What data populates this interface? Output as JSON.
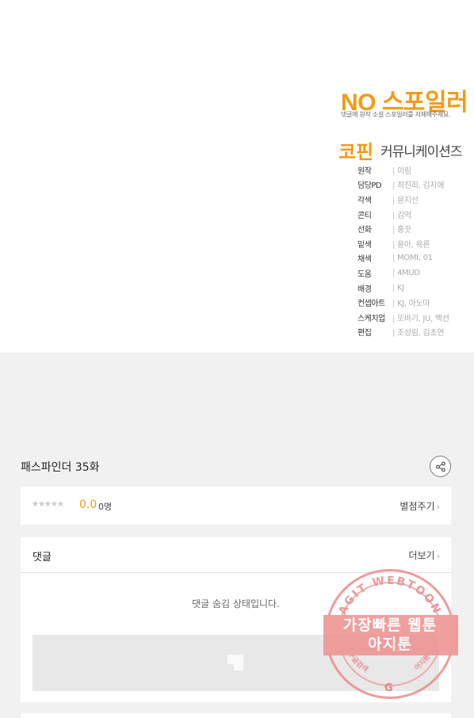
{
  "panel": {
    "no_spoiler": "NO 스포일러",
    "no_spoiler_sub": "댓글에 원작 소설 스포일러를 자제해주세요.",
    "copin": "코핀",
    "copin_sub": "커뮤니케이션즈",
    "credits": [
      {
        "role": "원작",
        "name": "이림"
      },
      {
        "role": "담당PD",
        "name": "최진희, 김지애"
      },
      {
        "role": "각색",
        "name": "윤지선"
      },
      {
        "role": "콘티",
        "name": "김억"
      },
      {
        "role": "선화",
        "name": "홍끗"
      },
      {
        "role": "밑색",
        "name": "용아, 욕른"
      },
      {
        "role": "채색",
        "name": "MOMI, 01"
      },
      {
        "role": "도움",
        "name": "4MUD"
      },
      {
        "role": "배경",
        "name": "KJ"
      },
      {
        "role": "컨셉아트",
        "name": "KJ, 아노마"
      },
      {
        "role": "스케치업",
        "name": "또바기, JU, 백선"
      },
      {
        "role": "편집",
        "name": "조성림, 김초연"
      }
    ]
  },
  "episode": {
    "title": "패스파인더 35화",
    "share_icon": "share-icon"
  },
  "rating": {
    "stars": "★★★★★",
    "value": "0.0",
    "count": "0명",
    "rate_button": "별점주기",
    "chevron": "›"
  },
  "comments": {
    "label": "댓글",
    "more_button": "더보기",
    "chevron": "›",
    "hidden_message": "댓글 숨김 상태입니다."
  },
  "watermark": {
    "arc_text": "AGIT WEBTOON",
    "line1": "가장빠른 웹툰",
    "line2": "아지툰",
    "bottom_left": "구글검색",
    "bottom_right": "아지툰",
    "g": "G"
  },
  "colors": {
    "accent": "#f39a12",
    "page_bg": "#f1f1f1",
    "card_bg": "#ffffff",
    "watermark": "#ee8f8f"
  }
}
